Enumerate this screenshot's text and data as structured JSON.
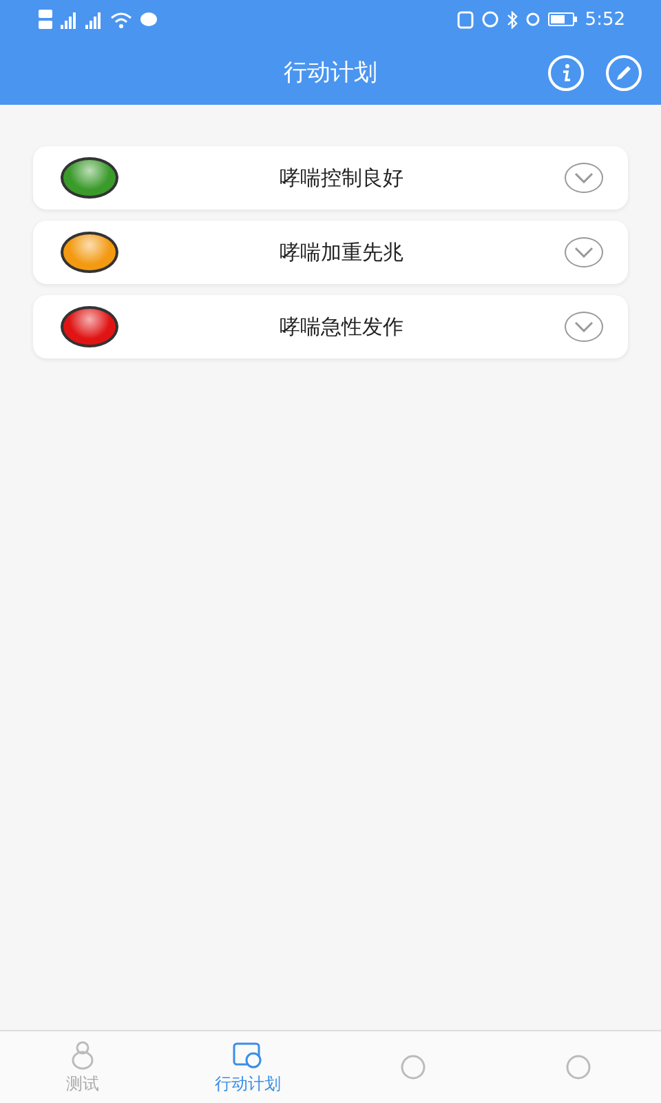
{
  "status_bar": {
    "time": "5:52"
  },
  "header": {
    "title": "行动计划"
  },
  "zones": [
    {
      "label": "哮喘控制良好",
      "color": "#3a9a2a",
      "expanded": false
    },
    {
      "label": "哮喘加重先兆",
      "color": "#f39a12",
      "expanded": false
    },
    {
      "label": "哮喘急性发作",
      "color": "#e01414",
      "expanded": false
    }
  ],
  "tabs": [
    {
      "kind": "test",
      "label": "测试",
      "selected": false
    },
    {
      "kind": "plan",
      "label": "行动计划",
      "selected": true
    },
    {
      "kind": "other",
      "selected": false
    },
    {
      "kind": "other",
      "selected": false
    }
  ]
}
